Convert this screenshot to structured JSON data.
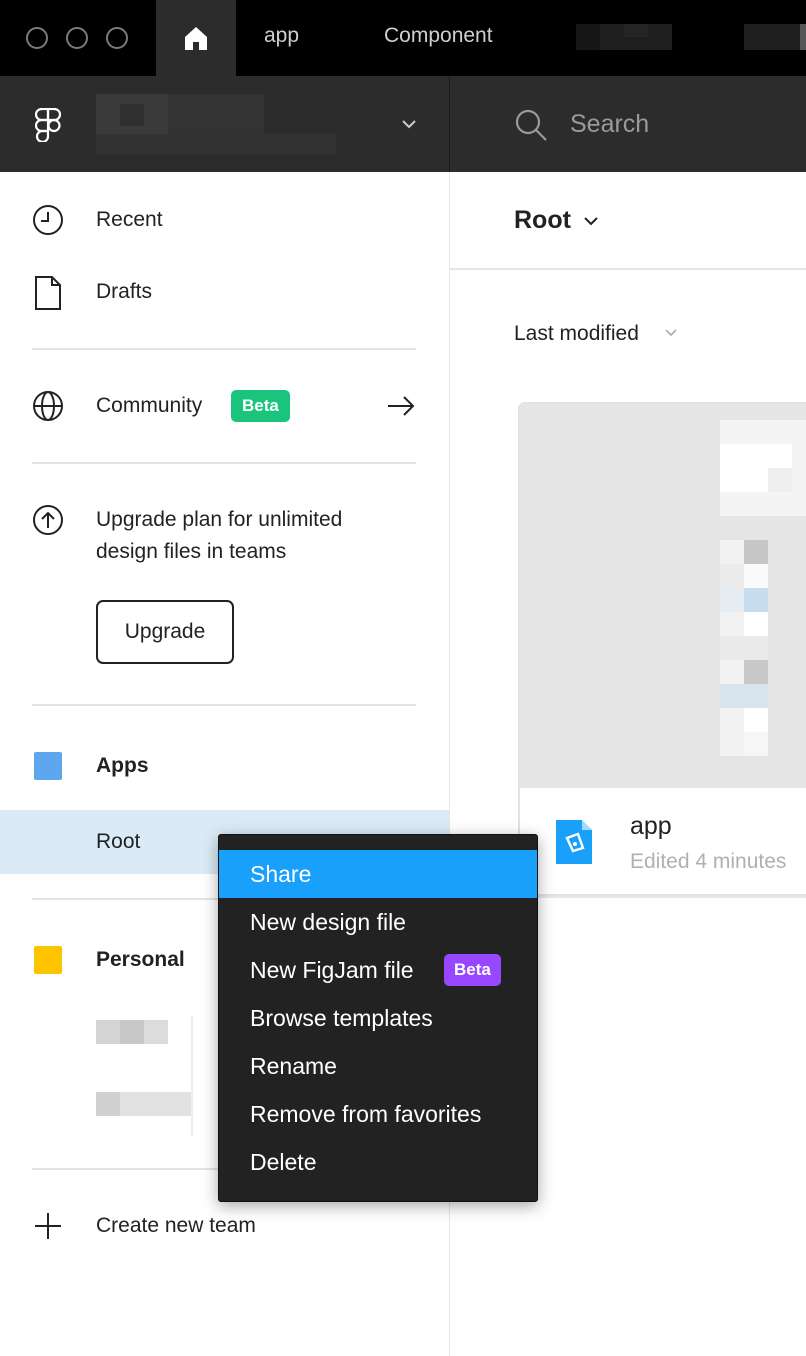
{
  "titlebar": {
    "tabs": [
      {
        "label": "app"
      },
      {
        "label": "Component"
      }
    ]
  },
  "header": {
    "search_placeholder": "Search"
  },
  "sidebar": {
    "nav": {
      "recent": "Recent",
      "drafts": "Drafts",
      "community": "Community",
      "community_badge": "Beta"
    },
    "upgrade": {
      "text_line1": "Upgrade plan for unlimited",
      "text_line2": "design files in teams",
      "button": "Upgrade"
    },
    "teams": {
      "apps": {
        "name": "Apps",
        "color": "#5ea6f0",
        "project": "Root"
      },
      "personal": {
        "name": "Personal",
        "color": "#ffc400"
      }
    },
    "create_team": "Create new team"
  },
  "main": {
    "title": "Root",
    "sort": "Last modified",
    "file": {
      "name": "app",
      "edited": "Edited 4 minutes"
    }
  },
  "context_menu": {
    "items": [
      {
        "label": "Share"
      },
      {
        "label": "New design file"
      },
      {
        "label": "New FigJam file"
      },
      {
        "label": "Browse templates"
      },
      {
        "label": "Rename"
      },
      {
        "label": "Remove from favorites"
      },
      {
        "label": "Delete"
      }
    ],
    "figjam_badge": "Beta",
    "active_color": "#18a0fb"
  }
}
